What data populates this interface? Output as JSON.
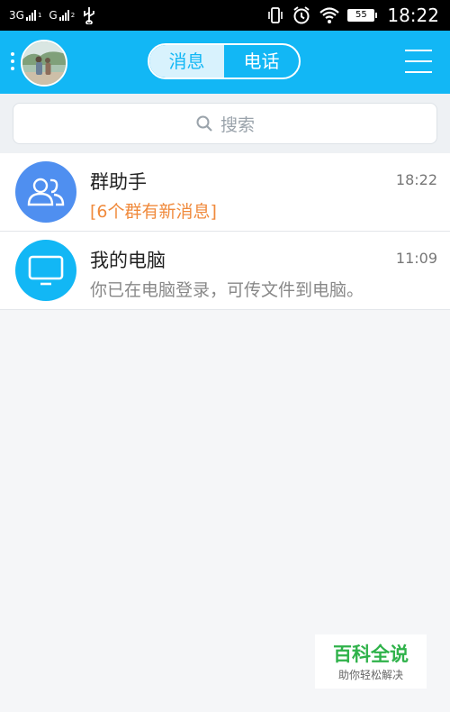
{
  "status_bar": {
    "network1": "3G",
    "network2": "G",
    "sim1_index": "1",
    "sim2_index": "2",
    "battery": "55",
    "time": "18:22"
  },
  "header": {
    "tabs": [
      {
        "label": "消息",
        "active": true
      },
      {
        "label": "电话",
        "active": false
      }
    ]
  },
  "search": {
    "placeholder": "搜索"
  },
  "conversations": [
    {
      "title": "群助手",
      "time": "18:22",
      "subtitle": "[6个群有新消息]",
      "icon": "group-icon",
      "icon_color": "#4f8ff0",
      "subtitle_color": "#f08a3c"
    },
    {
      "title": "我的电脑",
      "time": "11:09",
      "subtitle": "你已在电脑登录，可传文件到电脑。",
      "icon": "monitor-icon",
      "icon_color": "#12b7f5",
      "subtitle_color": "#888888"
    }
  ],
  "watermark": {
    "title": "百科全说",
    "subtitle": "助你轻松解决"
  },
  "colors": {
    "header_bg": "#12b7f5",
    "list_bg": "#ffffff",
    "page_bg": "#f5f6f8"
  }
}
